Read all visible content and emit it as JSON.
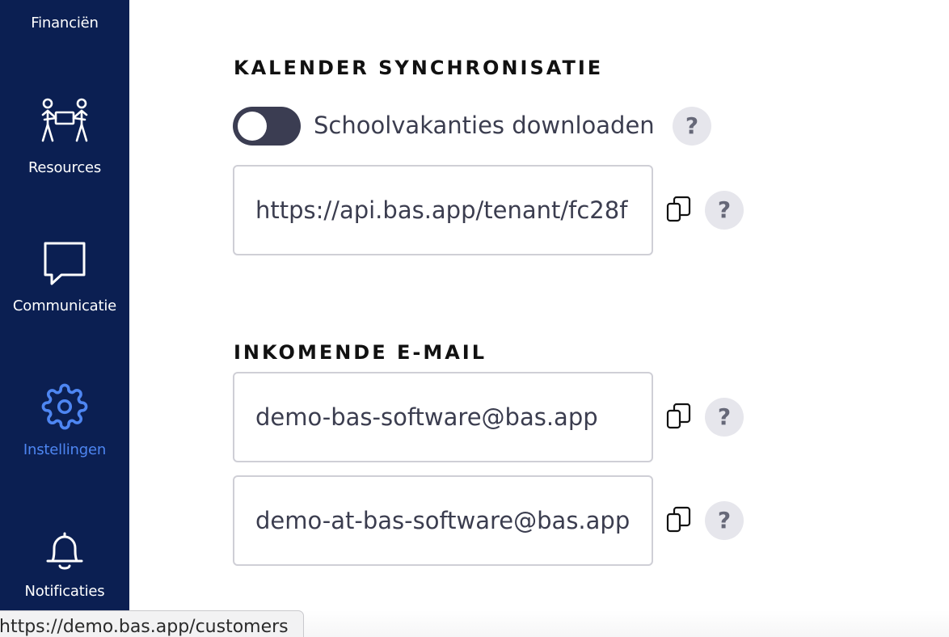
{
  "sidebar": {
    "items": [
      {
        "label": "Financiën",
        "icon": "finance-icon",
        "active": false
      },
      {
        "label": "Resources",
        "icon": "people-carrying-box-icon",
        "active": false
      },
      {
        "label": "Communicatie",
        "icon": "chat-bubble-icon",
        "active": false
      },
      {
        "label": "Instellingen",
        "icon": "gear-icon",
        "active": true
      },
      {
        "label": "Notificaties",
        "icon": "bell-icon",
        "active": false
      }
    ]
  },
  "colors": {
    "sidebar_bg": "#0b1f52",
    "active": "#4e86f2",
    "toggle_off": "#3b3d52"
  },
  "calendar": {
    "title": "KALENDER SYNCHRONISATIE",
    "toggle_label": "Schoolvakanties downloaden",
    "toggle_on": false,
    "feed_url": "https://api.bas.app/tenant/fc28f"
  },
  "email": {
    "title": "INKOMENDE E-MAIL",
    "address_1": "demo-bas-software@bas.app",
    "address_2": "demo-at-bas-software@bas.app"
  },
  "help_symbol": "?",
  "status_url": "https://demo.bas.app/customers"
}
